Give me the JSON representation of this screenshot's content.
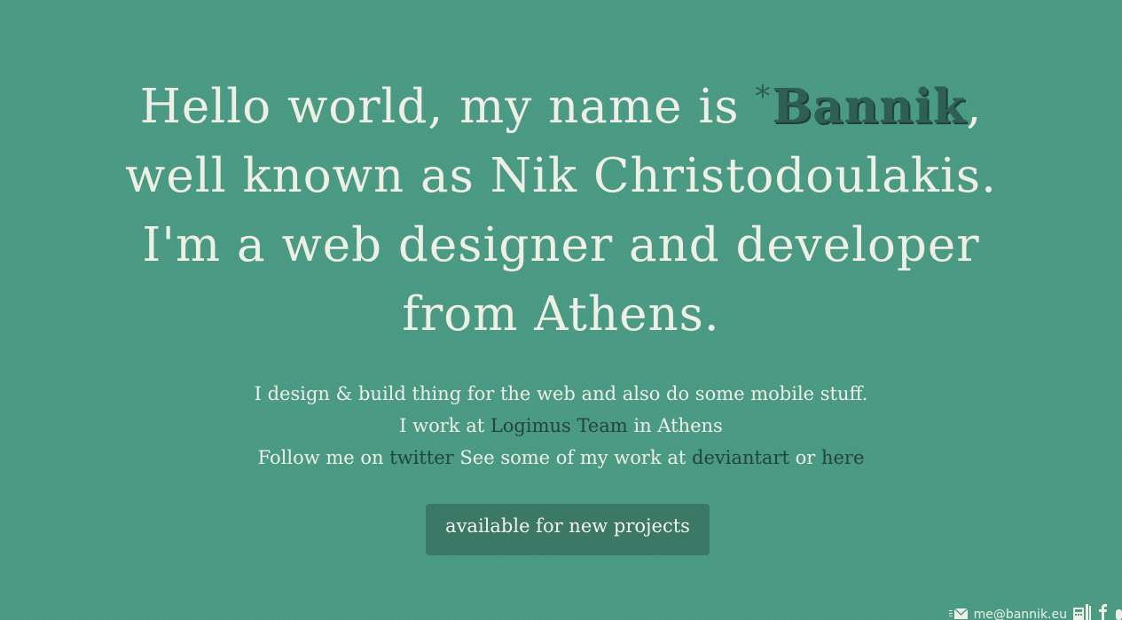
{
  "headline": {
    "line1_prefix": "Hello world, my name is ",
    "brand_star": "*",
    "brand_name": "Bannik",
    "line1_suffix": ",",
    "line2": "well known as Nik Christodoulakis.",
    "line3": "I'm a web designer and developer",
    "line4": "from Athens."
  },
  "intro": {
    "row1": "I design & build thing for the web and also do some mobile stuff.",
    "row2_prefix": "I work at ",
    "row2_link": "Logimus Team",
    "row2_suffix": " in Athens",
    "row3_prefix": "Follow me on ",
    "row3_link_twitter": "twitter",
    "row3_middle": " See some of my work at ",
    "row3_link_deviantart": "deviantart",
    "row3_or": " or ",
    "row3_link_here": "here"
  },
  "cta": {
    "label": "available for new projects"
  },
  "footer": {
    "email": "me@bannik.eu",
    "icons": [
      "mail-icon",
      "phone-icon",
      "facebook-icon"
    ]
  },
  "colors": {
    "background": "#4a9a84",
    "text": "#eef0e6",
    "link": "#22443c",
    "brand": "#2f5f54",
    "button": "#3b7866"
  }
}
